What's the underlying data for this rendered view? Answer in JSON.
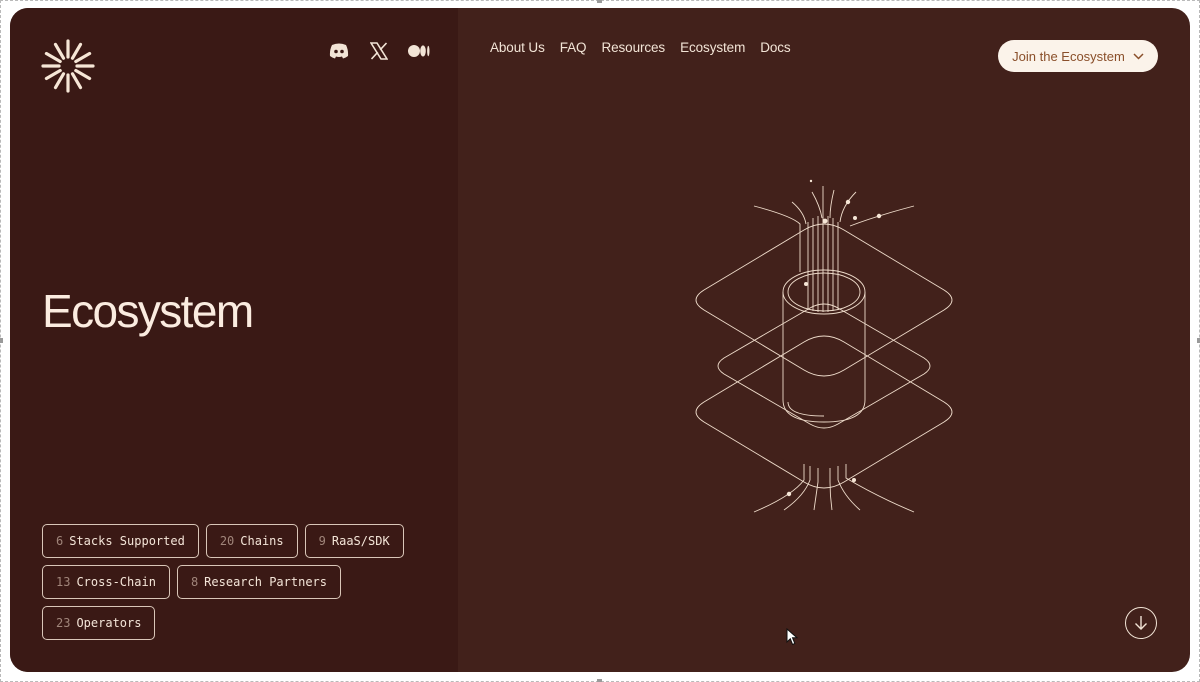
{
  "header": {
    "socials": [
      {
        "icon": "discord-icon"
      },
      {
        "icon": "x-icon"
      },
      {
        "icon": "medium-icon"
      }
    ],
    "nav": [
      "About Us",
      "FAQ",
      "Resources",
      "Ecosystem",
      "Docs"
    ],
    "cta": {
      "label": "Join the Ecosystem",
      "icon": "chevron-down-icon"
    }
  },
  "hero": {
    "title": "Ecosystem"
  },
  "tags": [
    [
      {
        "num": "6",
        "label": "Stacks Supported"
      },
      {
        "num": "20",
        "label": "Chains"
      },
      {
        "num": "9",
        "label": "RaaS/SDK"
      }
    ],
    [
      {
        "num": "13",
        "label": "Cross-Chain"
      },
      {
        "num": "8",
        "label": "Research Partners"
      }
    ],
    [
      {
        "num": "23",
        "label": "Operators"
      }
    ]
  ],
  "colors": {
    "card_bg": "#42211b",
    "left_panel_bg": "#3a1915",
    "text": "#f2e4d6",
    "cta_bg": "#fbf3ea",
    "cta_text": "#8a4f2a",
    "tag_number": "#a0857a"
  }
}
